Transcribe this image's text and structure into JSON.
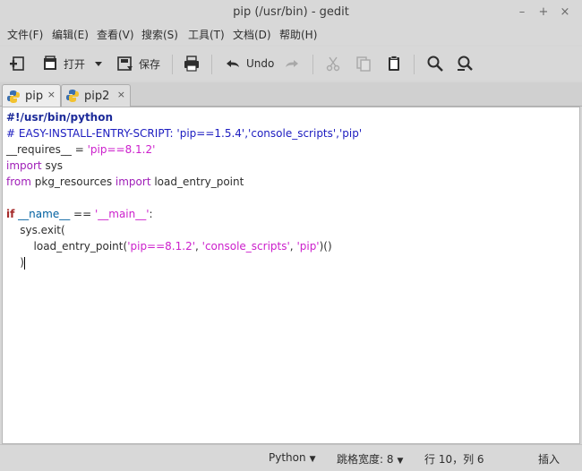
{
  "window": {
    "title": "pip (/usr/bin) - gedit",
    "controls": [
      "–",
      "+",
      "×"
    ]
  },
  "menu": [
    "文件(F)",
    "编辑(E)",
    "查看(V)",
    "搜索(S)",
    "工具(T)",
    "文档(D)",
    "帮助(H)"
  ],
  "toolbar": {
    "open_label": "打开",
    "save_label": "保存",
    "undo_label": "Undo"
  },
  "tabs": [
    {
      "label": "pip",
      "close": "×"
    },
    {
      "label": "pip2",
      "close": "×"
    }
  ],
  "editor": {
    "lines": [
      {
        "parts": [
          {
            "cls": "kw-shebang",
            "text": "#!/usr/bin/python"
          }
        ]
      },
      {
        "parts": [
          {
            "cls": "comment",
            "text": "# EASY-INSTALL-ENTRY-SCRIPT: 'pip==1.5.4','console_scripts','pip'"
          }
        ]
      },
      {
        "parts": [
          {
            "cls": "",
            "text": "__requires__ = "
          },
          {
            "cls": "string",
            "text": "'pip==8.1.2'"
          }
        ]
      },
      {
        "parts": [
          {
            "cls": "keyword",
            "text": "import"
          },
          {
            "cls": "",
            "text": " sys"
          }
        ]
      },
      {
        "parts": [
          {
            "cls": "keyword",
            "text": "from"
          },
          {
            "cls": "",
            "text": " pkg_resources "
          },
          {
            "cls": "keyword",
            "text": "import"
          },
          {
            "cls": "",
            "text": " load_entry_point"
          }
        ]
      },
      {
        "parts": []
      },
      {
        "parts": [
          {
            "cls": "kw-if",
            "text": "if"
          },
          {
            "cls": "",
            "text": " "
          },
          {
            "cls": "builtin",
            "text": "__name__"
          },
          {
            "cls": "",
            "text": " == "
          },
          {
            "cls": "string",
            "text": "'__main__'"
          },
          {
            "cls": "",
            "text": ":"
          }
        ]
      },
      {
        "parts": [
          {
            "cls": "",
            "text": "    sys.exit("
          }
        ]
      },
      {
        "parts": [
          {
            "cls": "",
            "text": "        load_entry_point("
          },
          {
            "cls": "string",
            "text": "'pip==8.1.2'"
          },
          {
            "cls": "",
            "text": ", "
          },
          {
            "cls": "string",
            "text": "'console_scripts'"
          },
          {
            "cls": "",
            "text": ", "
          },
          {
            "cls": "string",
            "text": "'pip'"
          },
          {
            "cls": "",
            "text": ")()"
          }
        ]
      },
      {
        "parts": [
          {
            "cls": "",
            "text": "    )"
          }
        ],
        "caret": true
      }
    ]
  },
  "status": {
    "language": "Python",
    "tab_width": "跳格宽度: 8",
    "position": "行 10，列 6",
    "mode": "插入"
  }
}
